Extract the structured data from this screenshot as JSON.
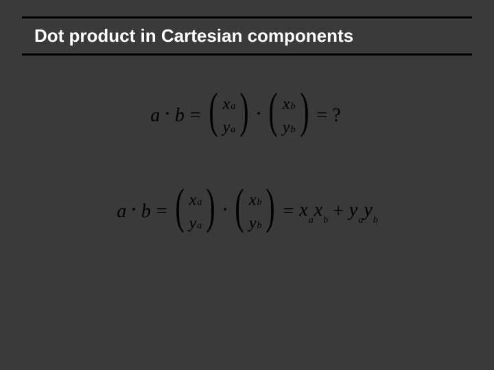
{
  "title": "Dot product in Cartesian components",
  "eq": {
    "lhs_a": "a",
    "lhs_b": "b",
    "dot": "•",
    "eq": "=",
    "lparen": "(",
    "rparen": ")",
    "xa_x": "x",
    "xa_s": "a",
    "ya_y": "y",
    "ya_s": "a",
    "xb_x": "x",
    "xb_s": "b",
    "yb_y": "y",
    "yb_s": "b",
    "q": "= ?",
    "plus": "+"
  }
}
